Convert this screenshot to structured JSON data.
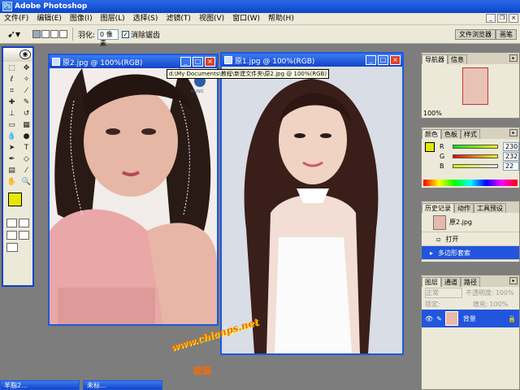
{
  "app": {
    "title": "Adobe Photoshop"
  },
  "menu": {
    "items": [
      "文件(F)",
      "编辑(E)",
      "图像(I)",
      "图层(L)",
      "选择(S)",
      "滤镜(T)",
      "视图(V)",
      "窗口(W)",
      "帮助(H)"
    ]
  },
  "options": {
    "feather_label": "羽化:",
    "feather_value": "0 像素",
    "antialias_label": "消除锯齿",
    "well_tabs": [
      "文件浏览器",
      "画笔"
    ]
  },
  "doc2": {
    "title": "原2.jpg @ 100%(RGB)"
  },
  "doc1": {
    "title": "原1.jpg @ 100%(RGB)"
  },
  "tooltip": {
    "path": "d:\\My Documents\\教程\\新建文件夹\\原2.jpg @ 100%(RGB)"
  },
  "watermark": {
    "url": "www.chianps.net",
    "sub": "能猫"
  },
  "navigator": {
    "tabs": [
      "导航器",
      "信息"
    ],
    "zoom": "100%"
  },
  "color_panel": {
    "tabs": [
      "颜色",
      "色板",
      "样式"
    ],
    "r_label": "R",
    "g_label": "G",
    "b_label": "B",
    "r": "230",
    "g": "232",
    "b": "22"
  },
  "history": {
    "tabs": [
      "历史记录",
      "动作",
      "工具预设"
    ],
    "snapshot": "原2.jpg",
    "items": [
      "打开",
      "多边形套索"
    ]
  },
  "layers": {
    "tabs": [
      "图层",
      "通道",
      "路径"
    ],
    "blend": "正常",
    "opacity_label": "不透明度:",
    "opacity": "100%",
    "lock_label": "锁定:",
    "fill_label": "填充:",
    "fill": "100%",
    "layer_name": "背景"
  },
  "minimized": [
    {
      "label": "羊脂2..."
    },
    {
      "label": "未标..."
    }
  ],
  "colors": {
    "foreground": "#e6e600",
    "background": "#000000",
    "accent": "#2255dd"
  }
}
